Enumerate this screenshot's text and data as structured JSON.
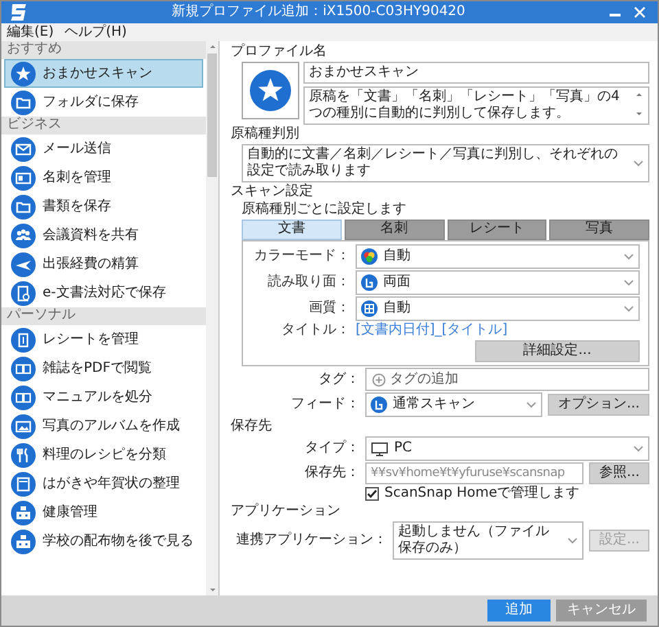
{
  "window": {
    "title": "新規プロファイル追加：iX1500-C03HY90420"
  },
  "menu": [
    "編集(E)",
    "ヘルプ(H)"
  ],
  "sidebar": {
    "groups": [
      {
        "header": "おすすめ",
        "items": [
          {
            "label": "おまかせスキャン",
            "selected": true
          },
          {
            "label": "フォルダに保存",
            "selected": false
          }
        ]
      },
      {
        "header": "ビジネス",
        "items": [
          {
            "label": "メール送信",
            "selected": false
          },
          {
            "label": "名刺を管理",
            "selected": false
          },
          {
            "label": "書類を保存",
            "selected": false
          },
          {
            "label": "会議資料を共有",
            "selected": false
          },
          {
            "label": "出張経費の精算",
            "selected": false
          },
          {
            "label": "e-文書法対応で保存",
            "selected": false
          }
        ]
      },
      {
        "header": "パーソナル",
        "items": [
          {
            "label": "レシートを管理",
            "selected": false
          },
          {
            "label": "雑誌をPDFで閲覧",
            "selected": false
          },
          {
            "label": "マニュアルを処分",
            "selected": false
          },
          {
            "label": "写真のアルバムを作成",
            "selected": false
          },
          {
            "label": "料理のレシピを分類",
            "selected": false
          },
          {
            "label": "はがきや年賀状の整理",
            "selected": false
          },
          {
            "label": "健康管理",
            "selected": false
          },
          {
            "label": "学校の配布物を後で見る",
            "selected": false
          }
        ]
      }
    ]
  },
  "profile": {
    "label": "プロファイル名",
    "name": "おまかせスキャン",
    "description": "原稿を「文書」「名刺」「レシート」「写真」の4つの種別に自動的に判別して保存します。"
  },
  "classification": {
    "label": "原稿種判別",
    "value": "自動的に文書／名刺／レシート／写真に判別し、それぞれの設定で読み取ります"
  },
  "scan": {
    "label": "スキャン設定",
    "note": "原稿種別ごとに設定します",
    "tabs": [
      {
        "label": "文書",
        "selected": true
      },
      {
        "label": "名刺",
        "selected": false
      },
      {
        "label": "レシート",
        "selected": false
      },
      {
        "label": "写真",
        "selected": false
      }
    ],
    "fields": [
      {
        "kind": "color",
        "label": "カラーモード：",
        "value": "自動"
      },
      {
        "kind": "side",
        "label": "読み取り面：",
        "value": "両面"
      },
      {
        "kind": "quality",
        "label": "画質：",
        "value": "自動"
      }
    ],
    "title_label": "タイトル：",
    "title_value": "[文書内日付]_[タイトル]",
    "details_button": "詳細設定..."
  },
  "tag": {
    "label": "タグ：",
    "add": "タグの追加"
  },
  "feed": {
    "label": "フィード：",
    "value": "通常スキャン",
    "button": "オプション..."
  },
  "destination": {
    "label": "保存先",
    "type_label": "タイプ：",
    "type_value": "PC",
    "path_label": "保存先：",
    "path": "¥¥sv¥home¥t¥yfuruse¥scansnap",
    "browse": "参照...",
    "manage": {
      "label": "ScanSnap Homeで管理します",
      "checked": true
    }
  },
  "application": {
    "label": "アプリケーション",
    "app_label": "連携アプリケーション：",
    "value": "起動しません（ファイル保存のみ）",
    "settings": {
      "label": "設定...",
      "disabled": true
    }
  },
  "buttons": [
    {
      "label": "追加",
      "primary": true
    },
    {
      "label": "キャンセル",
      "primary": false
    }
  ]
}
